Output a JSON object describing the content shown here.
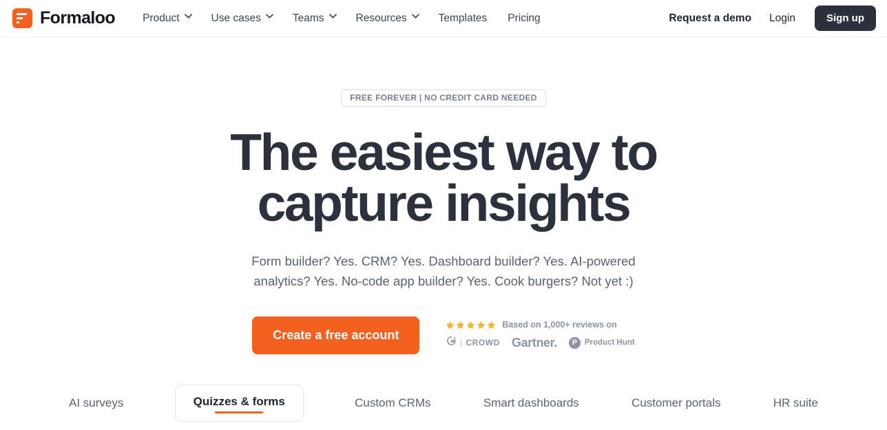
{
  "header": {
    "brand": {
      "name": "Formaloo",
      "icon": "formaloo-logo-icon",
      "color": "#f4601f"
    },
    "nav": [
      {
        "label": "Product",
        "has_dropdown": true
      },
      {
        "label": "Use cases",
        "has_dropdown": true
      },
      {
        "label": "Teams",
        "has_dropdown": true
      },
      {
        "label": "Resources",
        "has_dropdown": true
      },
      {
        "label": "Templates",
        "has_dropdown": false
      },
      {
        "label": "Pricing",
        "has_dropdown": false
      }
    ],
    "demo_label": "Request a demo",
    "login_label": "Login",
    "signup_label": "Sign up",
    "signup_color": "#2b323d"
  },
  "hero": {
    "badge": "FREE FOREVER | NO CREDIT CARD NEEDED",
    "headline_line1": "The easiest way to",
    "headline_line2": "capture insights",
    "headline_color": "#2b323d",
    "subheadline_line1": "Form builder? Yes. CRM? Yes. Dashboard builder? Yes. AI-powered",
    "subheadline_line2": "analytics? Yes. No-code app builder? Yes. Cook burgers? Not yet :)",
    "cta_label": "Create a free account",
    "cta_color": "#f4601f"
  },
  "reviews": {
    "star_count": 5,
    "star_color": "#f5b335",
    "text": "Based on 1,000+ reviews on",
    "platforms": [
      {
        "name": "G2 Crowd",
        "mark": "G2",
        "word": "CROWD"
      },
      {
        "name": "Gartner",
        "word": "Gartner."
      },
      {
        "name": "Product Hunt",
        "mark": "P",
        "word": "Product Hunt"
      }
    ]
  },
  "tabs": {
    "items": [
      {
        "label": "AI surveys",
        "active": false
      },
      {
        "label": "Quizzes & forms",
        "active": true
      },
      {
        "label": "Custom CRMs",
        "active": false
      },
      {
        "label": "Smart dashboards",
        "active": false
      },
      {
        "label": "Customer portals",
        "active": false
      },
      {
        "label": "HR suite",
        "active": false
      }
    ],
    "active_underline_color": "#f4601f"
  }
}
